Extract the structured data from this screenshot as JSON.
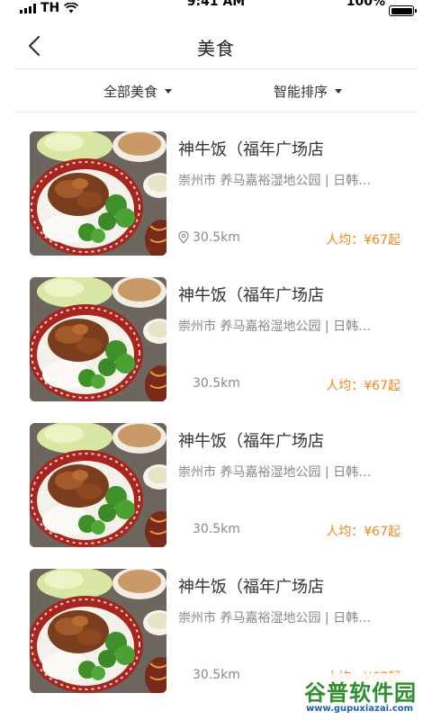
{
  "status_bar": {
    "time": "9:41 AM",
    "carrier": "TH",
    "battery_percent": "100%",
    "battery_level": 1.0
  },
  "nav": {
    "title": "美食",
    "back_icon": "chevron-left-icon"
  },
  "filters": [
    {
      "label": "全部美食",
      "icon": "caret-down-icon"
    },
    {
      "label": "智能排序",
      "icon": "caret-down-icon"
    }
  ],
  "restaurants": [
    {
      "name": "神牛饭（福年广场店",
      "description": "崇州市 养马嘉裕湿地公园 | 日韩…",
      "distance": "30.5km",
      "show_location_icon": true,
      "price": "人均：¥67起"
    },
    {
      "name": "神牛饭（福年广场店",
      "description": "崇州市 养马嘉裕湿地公园 | 日韩…",
      "distance": "30.5km",
      "show_location_icon": false,
      "price": "人均：¥67起"
    },
    {
      "name": "神牛饭（福年广场店",
      "description": "崇州市 养马嘉裕湿地公园 | 日韩…",
      "distance": "30.5km",
      "show_location_icon": false,
      "price": "人均：¥67起"
    },
    {
      "name": "神牛饭（福年广场店",
      "description": "崇州市 养马嘉裕湿地公园 | 日韩…",
      "distance": "30.5km",
      "show_location_icon": false,
      "price": "人均：¥67起"
    }
  ],
  "watermark": {
    "title": "谷普软件园",
    "url": "www.gupuxiazai.com"
  },
  "colors": {
    "price": "#f0861e",
    "muted_text": "#888888",
    "title_text": "#333333",
    "divider": "#e8e8e8"
  }
}
